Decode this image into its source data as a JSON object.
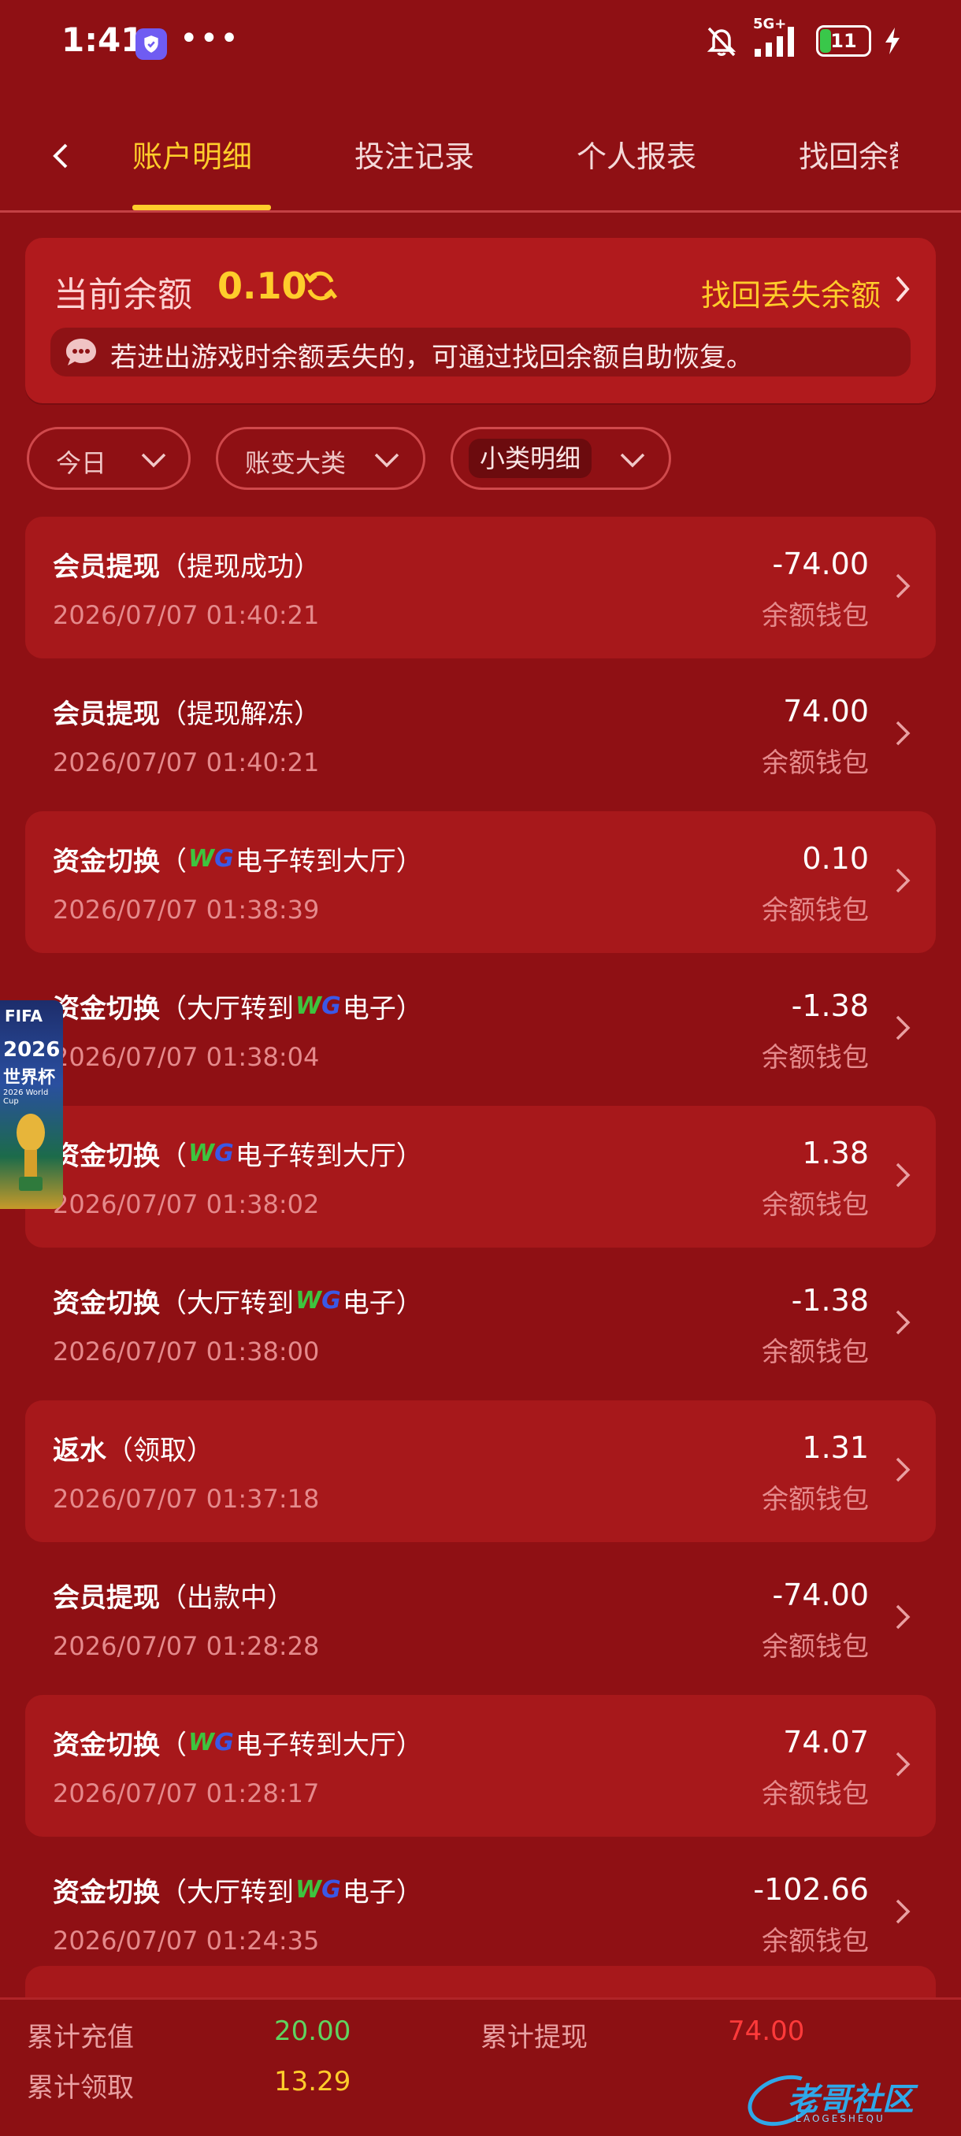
{
  "status_bar": {
    "time": "1:41",
    "network": "5G+",
    "battery": "11"
  },
  "tabs": [
    {
      "label": "账户明细"
    },
    {
      "label": "投注记录"
    },
    {
      "label": "个人报表"
    },
    {
      "label": "找回余额"
    }
  ],
  "balance": {
    "label": "当前余额",
    "value": "0.10",
    "recover_label": "找回丢失余额",
    "notice": "若进出游戏时余额丢失的，可通过找回余额自助恢复。"
  },
  "filters": [
    {
      "label": "今日"
    },
    {
      "label": "账变大类"
    },
    {
      "label": "小类明细"
    }
  ],
  "transactions": [
    {
      "title": "会员提现",
      "detail_pre": "（提现成功）",
      "has_logo": false,
      "detail_post": "",
      "time": "2026/07/07 01:40:21",
      "amount": "-74.00",
      "wallet": "余额钱包"
    },
    {
      "title": "会员提现",
      "detail_pre": "（提现解冻）",
      "has_logo": false,
      "detail_post": "",
      "time": "2026/07/07 01:40:21",
      "amount": "74.00",
      "wallet": "余额钱包"
    },
    {
      "title": "资金切换",
      "detail_pre": "（",
      "has_logo": true,
      "detail_post": "电子转到大厅）",
      "time": "2026/07/07 01:38:39",
      "amount": "0.10",
      "wallet": "余额钱包"
    },
    {
      "title": "资金切换",
      "detail_pre": "（大厅转到",
      "has_logo": true,
      "detail_post": "电子）",
      "time": "2026/07/07 01:38:04",
      "amount": "-1.38",
      "wallet": "余额钱包"
    },
    {
      "title": "资金切换",
      "detail_pre": "（",
      "has_logo": true,
      "detail_post": "电子转到大厅）",
      "time": "2026/07/07 01:38:02",
      "amount": "1.38",
      "wallet": "余额钱包"
    },
    {
      "title": "资金切换",
      "detail_pre": "（大厅转到",
      "has_logo": true,
      "detail_post": "电子）",
      "time": "2026/07/07 01:38:00",
      "amount": "-1.38",
      "wallet": "余额钱包"
    },
    {
      "title": "返水",
      "detail_pre": "（领取）",
      "has_logo": false,
      "detail_post": "",
      "time": "2026/07/07 01:37:18",
      "amount": "1.31",
      "wallet": "余额钱包"
    },
    {
      "title": "会员提现",
      "detail_pre": "（出款中）",
      "has_logo": false,
      "detail_post": "",
      "time": "2026/07/07 01:28:28",
      "amount": "-74.00",
      "wallet": "余额钱包"
    },
    {
      "title": "资金切换",
      "detail_pre": "（",
      "has_logo": true,
      "detail_post": "电子转到大厅）",
      "time": "2026/07/07 01:28:17",
      "amount": "74.07",
      "wallet": "余额钱包"
    },
    {
      "title": "资金切换",
      "detail_pre": "（大厅转到",
      "has_logo": true,
      "detail_post": "电子）",
      "time": "2026/07/07 01:24:35",
      "amount": "-102.66",
      "wallet": "余额钱包"
    }
  ],
  "logo_text": {
    "w": "W",
    "g": "G"
  },
  "worldcup_ad": {
    "badge": "FIFA",
    "year": "2026",
    "title_cn": "世界杯",
    "title_en": "2026 World Cup"
  },
  "summary": {
    "recharge_label": "累计充值",
    "recharge_value": "20.00",
    "withdraw_label": "累计提现",
    "withdraw_value": "74.00",
    "claim_label": "累计领取",
    "claim_value": "13.29"
  },
  "watermark": {
    "text": "老哥社区",
    "sub": "LAOGESHEQU"
  },
  "colors": {
    "accent": "#ffcd2b",
    "background": "#8f1014",
    "card": "#a7181b",
    "positive": "#5fd35f",
    "negative": "#ff3a3a"
  }
}
